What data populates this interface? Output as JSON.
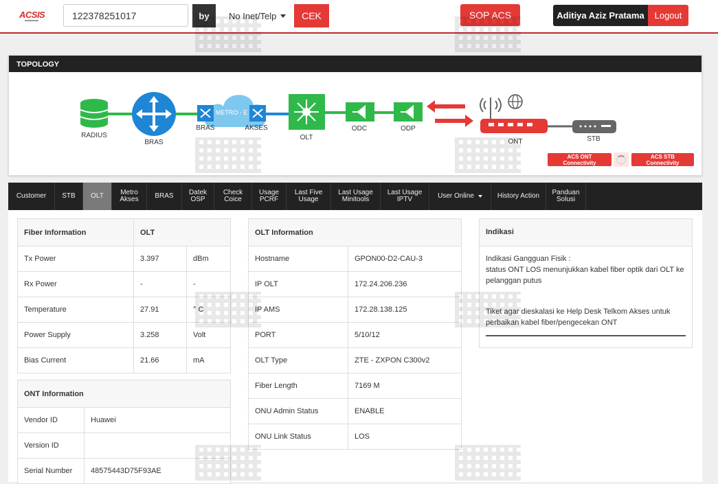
{
  "header": {
    "logo": "ACSIS",
    "search_value": "122378251017",
    "by_label": "by",
    "select_value": "No Inet/Telp",
    "cek_label": "CEK",
    "sop_label": "SOP ACS",
    "user_name": "Aditiya Aziz Pratama",
    "logout_label": "Logout"
  },
  "topology": {
    "title": "TOPOLOGY",
    "nodes": {
      "radius": "RADIUS",
      "bras": "BRAS",
      "bras2": "BRAS",
      "metro": "METRO - E",
      "akses": "AKSES",
      "olt": "OLT",
      "odc": "ODC",
      "odp": "ODP",
      "ont": "ONT",
      "stb": "STB"
    },
    "acs_ont_label": "ACS ONT Connectivity",
    "acs_stb_label": "ACS STB Connectivity",
    "colors": {
      "green": "#2fb94a",
      "blue": "#1f86d6",
      "red": "#e53935",
      "gray": "#666666"
    }
  },
  "tabs": [
    {
      "label": "Customer"
    },
    {
      "label": "STB"
    },
    {
      "label": "OLT"
    },
    {
      "label": "Metro Akses"
    },
    {
      "label": "BRAS"
    },
    {
      "label": "Datek OSP"
    },
    {
      "label": "Check Coice"
    },
    {
      "label": "Usage PCRF"
    },
    {
      "label": "Last Five Usage"
    },
    {
      "label": "Last Usage Minitools"
    },
    {
      "label": "Last Usage IPTV"
    },
    {
      "label": "User Online"
    },
    {
      "label": "History Action"
    },
    {
      "label": "Panduan Solusi"
    }
  ],
  "fiber": {
    "header_left": "Fiber Information",
    "header_right": "OLT",
    "rows": [
      {
        "label": "Tx Power",
        "value": "3.397",
        "unit": "dBm"
      },
      {
        "label": "Rx Power",
        "value": "-",
        "unit": "-"
      },
      {
        "label": "Temperature",
        "value": "27.91",
        "unit": "° C"
      },
      {
        "label": "Power Supply",
        "value": "3.258",
        "unit": "Volt"
      },
      {
        "label": "Bias Current",
        "value": "21.66",
        "unit": "mA"
      }
    ]
  },
  "ont_info": {
    "header": "ONT Information",
    "rows": [
      {
        "label": "Vendor ID",
        "value": "Huawei"
      },
      {
        "label": "Version ID",
        "value": ""
      },
      {
        "label": "Serial Number",
        "value": "48575443D75F93AE"
      }
    ]
  },
  "olt_info": {
    "header": "OLT Information",
    "rows": [
      {
        "label": "Hostname",
        "value": "GPON00-D2-CAU-3"
      },
      {
        "label": "IP OLT",
        "value": "172.24.206.236"
      },
      {
        "label": "IP AMS",
        "value": "172.28.138.125"
      },
      {
        "label": "PORT",
        "value": "5/10/12"
      },
      {
        "label": "OLT Type",
        "value": "ZTE - ZXPON C300v2"
      },
      {
        "label": "Fiber Length",
        "value": "7169 M"
      },
      {
        "label": "ONU Admin Status",
        "value": "ENABLE"
      },
      {
        "label": "ONU Link Status",
        "value": "LOS"
      }
    ]
  },
  "indikasi": {
    "header": "Indikasi",
    "line1": "Indikasi Gangguan Fisik :",
    "line2": "status ONT LOS menunjukkan kabel fiber optik dari OLT ke pelanggan putus",
    "line3": "Tiket agar dieskalasi ke Help Desk Telkom Akses untuk perbaikan kabel fiber/pengecekan ONT"
  }
}
